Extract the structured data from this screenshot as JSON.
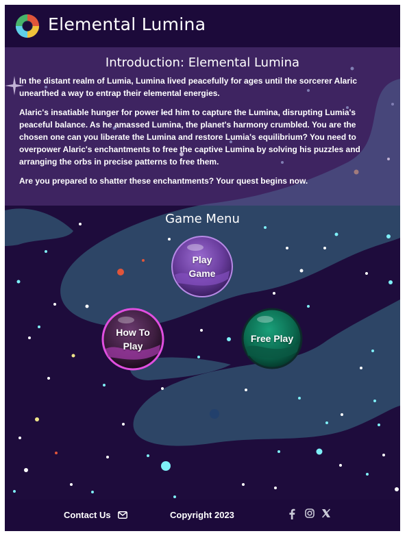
{
  "header": {
    "title": "Elemental Lumina",
    "logo_icon": "swirl-logo-icon"
  },
  "intro": {
    "title": "Introduction: Elemental Lumina",
    "paragraphs": [
      "In the distant realm of Lumia, Lumina lived peacefully for ages until the sorcerer Alaric unearthed a way to entrap their elemental energies.",
      "Alaric's insatiable hunger for power led him to capture the Lumina, disrupting Lumia's peaceful balance. As he amassed Lumina, the planet's harmony crumbled. You are the chosen one can you liberate the Lumina and restore Lumia's equilibrium? You need to overpower Alaric's enchantments to free the captive Lumina by solving his puzzles and arranging the orbs in precise patterns to free them.",
      "Are you prepared to shatter these enchantments? Your quest begins now."
    ]
  },
  "menu": {
    "title": "Game Menu",
    "play_line1": "Play",
    "play_line2": "Game",
    "how_line1": "How To",
    "how_line2": "Play",
    "free_label": "Free Play"
  },
  "footer": {
    "contact_label": "Contact Us",
    "contact_icon": "envelope-icon",
    "copyright": "Copyright 2023",
    "social_icons": [
      "facebook-icon",
      "instagram-icon",
      "x-icon"
    ]
  },
  "colors": {
    "background": "#1e0c3c",
    "nebula": "#2e4466",
    "intro_panel": "#5a3a86",
    "orb_purple": "#7a47b0",
    "orb_magenta": "#d94bd6",
    "orb_green": "#0f7a5c",
    "star_cyan": "#6ff0f8"
  }
}
